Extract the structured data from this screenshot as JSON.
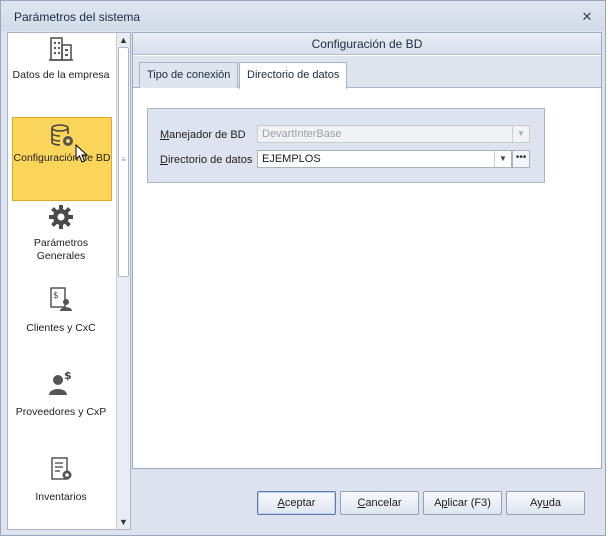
{
  "window": {
    "title": "Parámetros del sistema",
    "close_glyph": "✕"
  },
  "nav": {
    "items": [
      {
        "label": "Datos de la empresa",
        "icon": "building-icon"
      },
      {
        "label": "Configuración de BD",
        "icon": "database-gear-icon",
        "selected": true
      },
      {
        "label": "Parámetros\nGenerales",
        "icon": "gear-icon"
      },
      {
        "label": "Clientes y CxC",
        "icon": "customer-invoice-icon"
      },
      {
        "label": "Proveedores y CxP",
        "icon": "supplier-icon"
      },
      {
        "label": "Inventarios",
        "icon": "inventory-list-icon"
      }
    ],
    "scroll_up": "▲",
    "scroll_down": "▼",
    "grip": "≡"
  },
  "panel": {
    "header": "Configuración de BD",
    "tabs": [
      {
        "label": "Tipo de conexión",
        "active": false
      },
      {
        "label": "Directorio de datos",
        "active": true
      }
    ],
    "fields": {
      "manager_label_accel": "M",
      "manager_label_rest": "anejador de BD",
      "manager_value": "DevartInterBase",
      "directory_label_accel": "D",
      "directory_label_rest": "irectorio de datos",
      "directory_value": "EJEMPLOS",
      "browse_glyph": "•••",
      "dropdown_glyph": "▼"
    }
  },
  "buttons": {
    "accept_accel": "A",
    "accept_rest": "ceptar",
    "cancel_accel": "C",
    "cancel_rest": "ancelar",
    "apply_pre": "A",
    "apply_accel": "p",
    "apply_rest": "licar (F3)",
    "help_pre": "Ay",
    "help_accel": "u",
    "help_rest": "da"
  },
  "colors": {
    "selected_bg": "#fbd45a",
    "selected_border": "#e0a92b",
    "accent": "#5e79b0"
  }
}
